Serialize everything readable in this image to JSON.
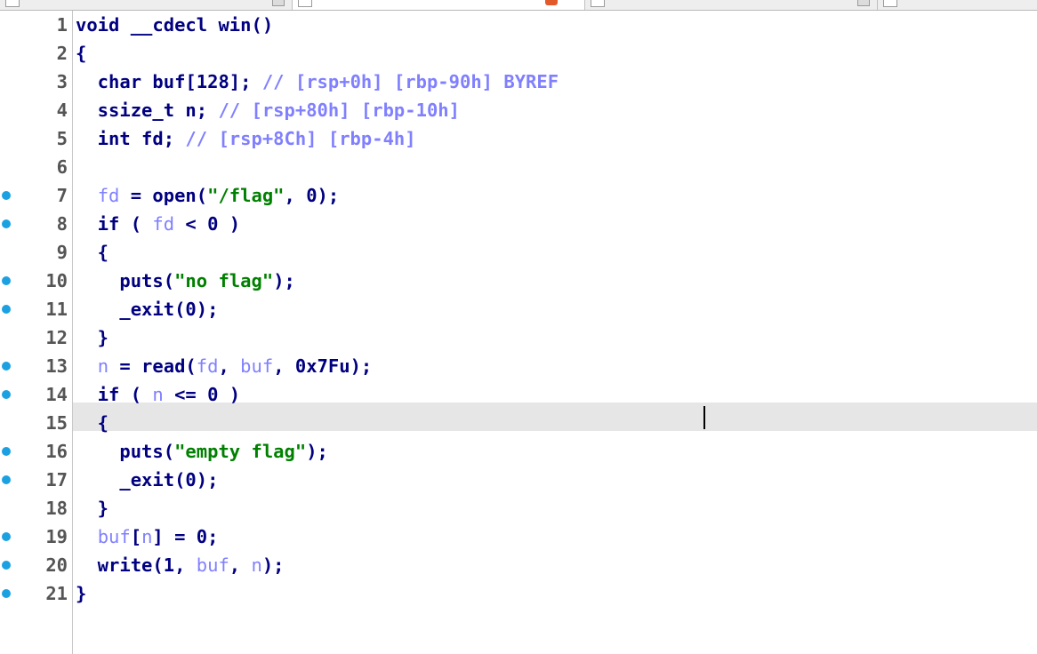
{
  "tabs": [
    {
      "label": "",
      "active": false
    },
    {
      "label": "",
      "active": true,
      "modified": true
    },
    {
      "label": "",
      "active": false
    },
    {
      "label": "",
      "active": false
    }
  ],
  "colors": {
    "keyword": "#000080",
    "string": "#008000",
    "comment": "#8080ff",
    "variable": "#8080ff",
    "breakpoint": "#1ba1e2",
    "current_line": "#e6e6e6"
  },
  "editor": {
    "current_line": 15,
    "lines": [
      {
        "n": "1",
        "bp": false,
        "tokens": [
          [
            "kw",
            "void __cdecl win()"
          ]
        ]
      },
      {
        "n": "2",
        "bp": false,
        "tokens": [
          [
            "kw",
            "{"
          ]
        ]
      },
      {
        "n": "3",
        "bp": false,
        "tokens": [
          [
            "kw",
            "  char buf[128]; "
          ],
          [
            "cmt",
            "// [rsp+0h] [rbp-90h] BYREF"
          ]
        ]
      },
      {
        "n": "4",
        "bp": false,
        "tokens": [
          [
            "kw",
            "  ssize_t n; "
          ],
          [
            "cmt",
            "// [rsp+80h] [rbp-10h]"
          ]
        ]
      },
      {
        "n": "5",
        "bp": false,
        "tokens": [
          [
            "kw",
            "  int fd; "
          ],
          [
            "cmt",
            "// [rsp+8Ch] [rbp-4h]"
          ]
        ]
      },
      {
        "n": "6",
        "bp": false,
        "tokens": [
          [
            "kw",
            ""
          ]
        ]
      },
      {
        "n": "7",
        "bp": true,
        "tokens": [
          [
            "kw",
            "  "
          ],
          [
            "var",
            "fd"
          ],
          [
            "kw",
            " = open("
          ],
          [
            "str",
            "\"/flag\""
          ],
          [
            "kw",
            ", 0);"
          ]
        ]
      },
      {
        "n": "8",
        "bp": true,
        "tokens": [
          [
            "kw",
            "  if ( "
          ],
          [
            "var",
            "fd"
          ],
          [
            "kw",
            " < 0 )"
          ]
        ]
      },
      {
        "n": "9",
        "bp": false,
        "tokens": [
          [
            "kw",
            "  {"
          ]
        ]
      },
      {
        "n": "10",
        "bp": true,
        "tokens": [
          [
            "kw",
            "    puts("
          ],
          [
            "str",
            "\"no flag\""
          ],
          [
            "kw",
            ");"
          ]
        ]
      },
      {
        "n": "11",
        "bp": true,
        "tokens": [
          [
            "kw",
            "    _exit(0);"
          ]
        ]
      },
      {
        "n": "12",
        "bp": false,
        "tokens": [
          [
            "kw",
            "  }"
          ]
        ]
      },
      {
        "n": "13",
        "bp": true,
        "tokens": [
          [
            "kw",
            "  "
          ],
          [
            "var",
            "n"
          ],
          [
            "kw",
            " = read("
          ],
          [
            "var",
            "fd"
          ],
          [
            "kw",
            ", "
          ],
          [
            "var",
            "buf"
          ],
          [
            "kw",
            ", 0x7Fu);"
          ]
        ]
      },
      {
        "n": "14",
        "bp": true,
        "tokens": [
          [
            "kw",
            "  if ( "
          ],
          [
            "var",
            "n"
          ],
          [
            "kw",
            " <= 0 )"
          ]
        ]
      },
      {
        "n": "15",
        "bp": false,
        "tokens": [
          [
            "kw",
            "  {"
          ]
        ]
      },
      {
        "n": "16",
        "bp": true,
        "tokens": [
          [
            "kw",
            "    puts("
          ],
          [
            "str",
            "\"empty flag\""
          ],
          [
            "kw",
            ");"
          ]
        ]
      },
      {
        "n": "17",
        "bp": true,
        "tokens": [
          [
            "kw",
            "    _exit(0);"
          ]
        ]
      },
      {
        "n": "18",
        "bp": false,
        "tokens": [
          [
            "kw",
            "  }"
          ]
        ]
      },
      {
        "n": "19",
        "bp": true,
        "tokens": [
          [
            "kw",
            "  "
          ],
          [
            "var",
            "buf"
          ],
          [
            "kw",
            "["
          ],
          [
            "var",
            "n"
          ],
          [
            "kw",
            "] = 0;"
          ]
        ]
      },
      {
        "n": "20",
        "bp": true,
        "tokens": [
          [
            "kw",
            "  write(1, "
          ],
          [
            "var",
            "buf"
          ],
          [
            "kw",
            ", "
          ],
          [
            "var",
            "n"
          ],
          [
            "kw",
            ");"
          ]
        ]
      },
      {
        "n": "21",
        "bp": true,
        "tokens": [
          [
            "kw",
            "}"
          ]
        ]
      }
    ]
  }
}
